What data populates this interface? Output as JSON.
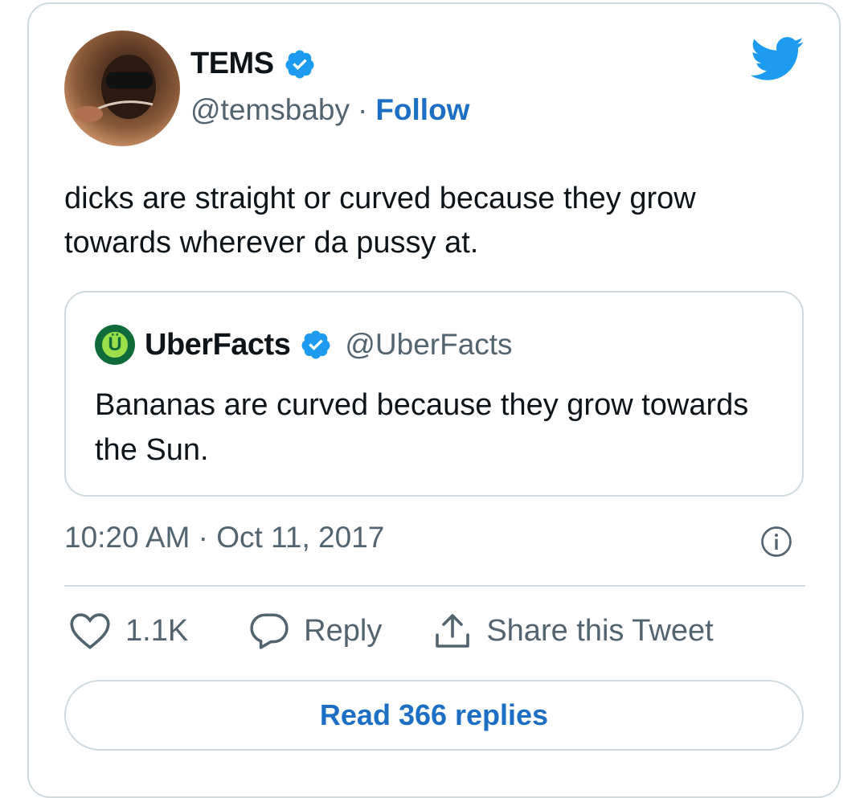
{
  "tweet": {
    "author_name": "TEMS",
    "author_handle": "@temsbaby",
    "separator": "·",
    "follow_label": "Follow",
    "text": "dicks are straight or curved because they grow towards wherever da pussy at.",
    "timestamp": "10:20 AM · Oct 11, 2017"
  },
  "quote": {
    "author_name": "UberFacts",
    "author_handle": "@UberFacts",
    "logo_letter": "Ü",
    "text": "Bananas are curved because they grow towards the Sun."
  },
  "actions": {
    "like_count": "1.1K",
    "reply_label": "Reply",
    "share_label": "Share this Tweet"
  },
  "read_replies_label": "Read 366 replies",
  "icons": [
    "verified-badge-icon",
    "twitter-bird-icon",
    "info-icon",
    "heart-icon",
    "reply-bubble-icon",
    "share-icon"
  ],
  "colors": {
    "twitter_blue": "#1d9bf0",
    "link_blue": "#1d6fc4",
    "secondary_text": "#536471",
    "border": "#cfd9de"
  }
}
